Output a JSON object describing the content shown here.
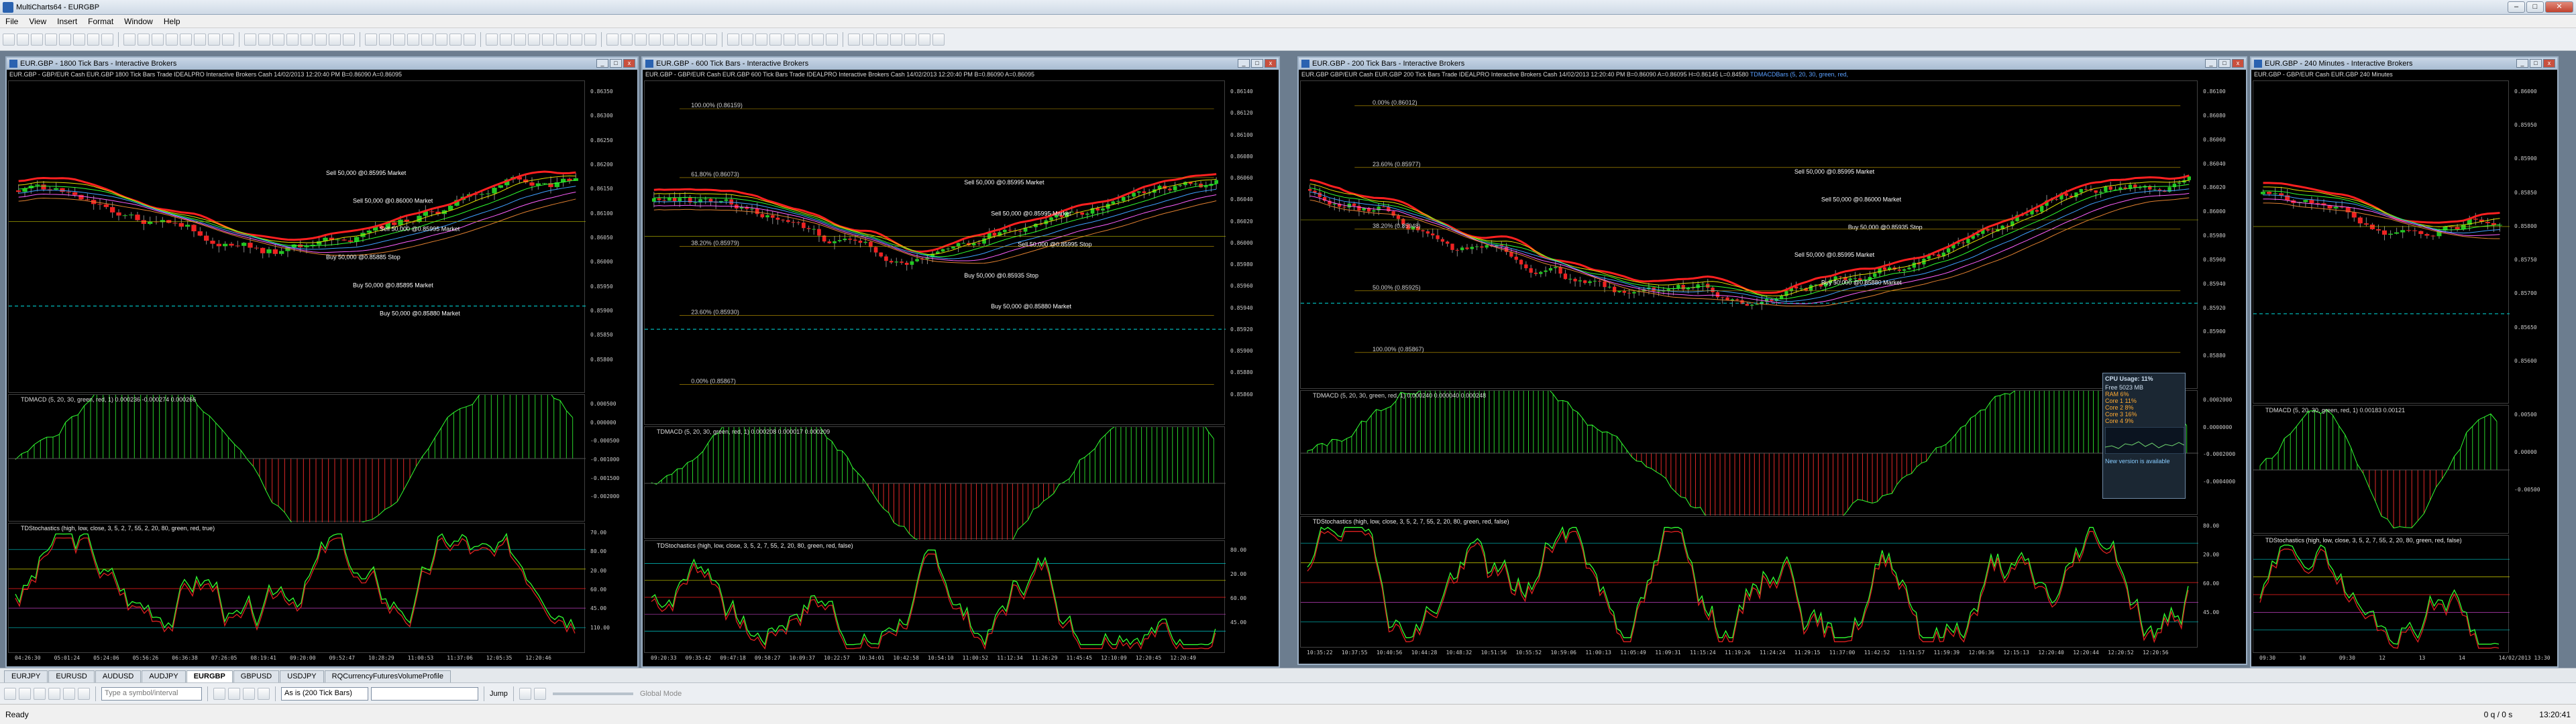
{
  "app": {
    "title": "MultiCharts64 - EURGBP"
  },
  "menu": [
    "File",
    "View",
    "Insert",
    "Format",
    "Window",
    "Help"
  ],
  "windows": [
    {
      "title": "EUR.GBP - 1800 Tick Bars - Interactive Brokers",
      "info": "EUR.GBP - GBP/EUR Cash EUR.GBP  1800 Tick Bars   Trade  IDEALPRO  Interactive Brokers  Cash  14/02/2013  12:20:40 PM  B=0.86090  A=0.86095",
      "price_labels": [
        "0.86350",
        "0.86300",
        "0.86250",
        "0.86200",
        "0.86150",
        "0.86100",
        "0.86050",
        "0.86000",
        "0.85950",
        "0.85900",
        "0.85850",
        "0.85800"
      ],
      "macd_label": "TDMACD  (5, 20, 30, green, red, 1)  0.000236  -0.000274  0.000266",
      "macd_axis": [
        "0.000500",
        "0.000000",
        "-0.000500",
        "-0.001000",
        "-0.001500",
        "-0.002000"
      ],
      "stoch_label": "TDStochastics  (high, low, close, 3, 5, 2, 7, 55, 2, 20, 80, green, red, true)",
      "stoch_values": [
        "70.00",
        "80.00",
        "20.00",
        "60.00",
        "45.00",
        "110.00"
      ],
      "times": [
        "04:26:30",
        "05:01:24",
        "05:24:06",
        "05:56:26",
        "06:36:38",
        "07:26:05",
        "08:19:41",
        "09:20:00",
        "09:52:47",
        "10:28:29",
        "11:00:53",
        "11:37:06",
        "12:05:35",
        "12:20:46"
      ],
      "trade_labels": [
        "Sell 50,000 @0.85995 Market",
        "Sell 50,000 @0.86000 Market",
        "Sell 50,000 @0.85995 Market",
        "Buy 50,000 @0.85885 Stop",
        "Buy 50,000 @0.85895 Market",
        "Buy 50,000 @0.85880 Market"
      ]
    },
    {
      "title": "EUR.GBP - 600 Tick Bars - Interactive Brokers",
      "info": "EUR.GBP - GBP/EUR Cash EUR.GBP  600 Tick Bars   Trade  IDEALPRO  Interactive Brokers  Cash  14/02/2013  12:20:40 PM  B=0.86090  A=0.86095",
      "price_labels": [
        "0.86140",
        "0.86120",
        "0.86100",
        "0.86080",
        "0.86060",
        "0.86040",
        "0.86020",
        "0.86000",
        "0.85980",
        "0.85960",
        "0.85940",
        "0.85920",
        "0.85900",
        "0.85880",
        "0.85860"
      ],
      "fib_labels": [
        "100.00% (0.86159)",
        "61.80% (0.86073)",
        "38.20% (0.85979)",
        "23.60% (0.85930)",
        "0.00% (0.85867)"
      ],
      "macd_label": "TDMACD  (5, 20, 30, green, red, 1)  0.000208  0.000017  0.000209",
      "stoch_label": "TDStochastics  (high, low, close, 3, 5, 2, 7, 55, 2, 20, 80, green, red, false)",
      "stoch_values": [
        "80.00",
        "20.00",
        "60.00",
        "45.00"
      ],
      "times": [
        "09:20:33",
        "09:35:42",
        "09:47:18",
        "09:58:27",
        "10:09:37",
        "10:22:57",
        "10:34:01",
        "10:42:58",
        "10:54:10",
        "11:00:52",
        "11:12:34",
        "11:26:29",
        "11:45:45",
        "12:10:09",
        "12:20:45",
        "12:20:49"
      ],
      "trade_labels": [
        "Sell 50,000 @0.85995 Market",
        "Sell 50,000 @0.85995 Market",
        "Sell 50,000 @0.85995 Stop",
        "Buy 50,000 @0.85935 Stop",
        "Buy 50,000 @0.85880 Market"
      ]
    },
    {
      "title": "EUR.GBP - 200 Tick Bars - Interactive Brokers",
      "info": "EUR.GBP   GBP/EUR Cash EUR.GBP  200 Tick Bars   Trade  IDEALPRO  Interactive Brokers  Cash  14/02/2013  12:20:40 PM  B=0.86090  A=0.86095  H=0.86145  L=0.84580",
      "info_tail": "TDMACDBars  (5, 20, 30, green, red,",
      "price_labels": [
        "0.86100",
        "0.86080",
        "0.86060",
        "0.86040",
        "0.86020",
        "0.86000",
        "0.85980",
        "0.85960",
        "0.85940",
        "0.85920",
        "0.85900",
        "0.85880"
      ],
      "fib_labels": [
        "0.00% (0.86012)",
        "23.60% (0.85977)",
        "38.20% (0.85948)",
        "50.00% (0.85925)",
        "100.00% (0.85867)"
      ],
      "macd_label": "TDMACD  (5, 20, 30, green, red, 1)  0.000240  0.000040  0.000248",
      "macd_axis": [
        "0.0002000",
        "0.0000000",
        "-0.0002000",
        "-0.0004000"
      ],
      "stoch_label": "TDStochastics  (high, low, close, 3, 5, 2, 7, 55, 2, 20, 80, green, red, false)",
      "stoch_values": [
        "80.00",
        "20.00",
        "60.00",
        "45.00"
      ],
      "times": [
        "10:35:22",
        "10:37:55",
        "10:40:56",
        "10:44:28",
        "10:48:32",
        "10:51:56",
        "10:55:52",
        "10:59:06",
        "11:00:13",
        "11:05:49",
        "11:09:31",
        "11:15:24",
        "11:19:26",
        "11:24:24",
        "11:29:15",
        "11:37:00",
        "11:42:52",
        "11:51:57",
        "11:59:39",
        "12:06:36",
        "12:15:13",
        "12:20:40",
        "12:20:44",
        "12:20:52",
        "12:20:56"
      ],
      "trade_labels": [
        "Sell 50,000 @0.85995 Market",
        "Sell 50,000 @0.86000 Market",
        "Buy 50,000 @0.85935 Stop",
        "Sell 50,000 @0.85995 Market",
        "Buy 50,000 @0.85880 Market"
      ],
      "cpu": {
        "title": "CPU Usage: 11%",
        "free": "Free 5023 MB",
        "rows": [
          "RAM 6%",
          "Core 1 11%",
          "Core 2 8%",
          "Core 3 16%",
          "Core 4 9%"
        ],
        "note": "New version is available"
      }
    },
    {
      "title": "EUR.GBP - 240 Minutes - Interactive Brokers",
      "info": "EUR.GBP - GBP/EUR Cash EUR.GBP  240 Minutes",
      "price_labels": [
        "0.86000",
        "0.85950",
        "0.85900",
        "0.85850",
        "0.85800",
        "0.85750",
        "0.85700",
        "0.85650",
        "0.85600"
      ],
      "macd_label": "TDMACD  (5, 20, 30, green, red, 1)  0.00183  0.00121",
      "macd_axis": [
        "0.00500",
        "0.00000",
        "-0.00500"
      ],
      "stoch_label": "TDStochastics  (high, low, close, 3, 5, 2, 7, 55, 2, 20, 80, green, red, false)",
      "times": [
        "09:30",
        "10",
        "09:30",
        "12",
        "13",
        "14",
        "14/02/2013 13:30"
      ]
    }
  ],
  "tabs": [
    "EURJPY",
    "EURUSD",
    "AUDUSD",
    "AUDJPY",
    "EURGBP",
    "GBPUSD",
    "USDJPY",
    "RQCurrencyFuturesVolumeProfile"
  ],
  "active_tab": "EURGBP",
  "bottombar": {
    "symbol_placeholder": "Type a symbol/interval",
    "resolution": "As is (200 Tick Bars)",
    "jump": "Jump",
    "global_mode": "Global Mode"
  },
  "status": {
    "left": "Ready",
    "conn": "0 q / 0 s",
    "clock": "13:20:41"
  }
}
